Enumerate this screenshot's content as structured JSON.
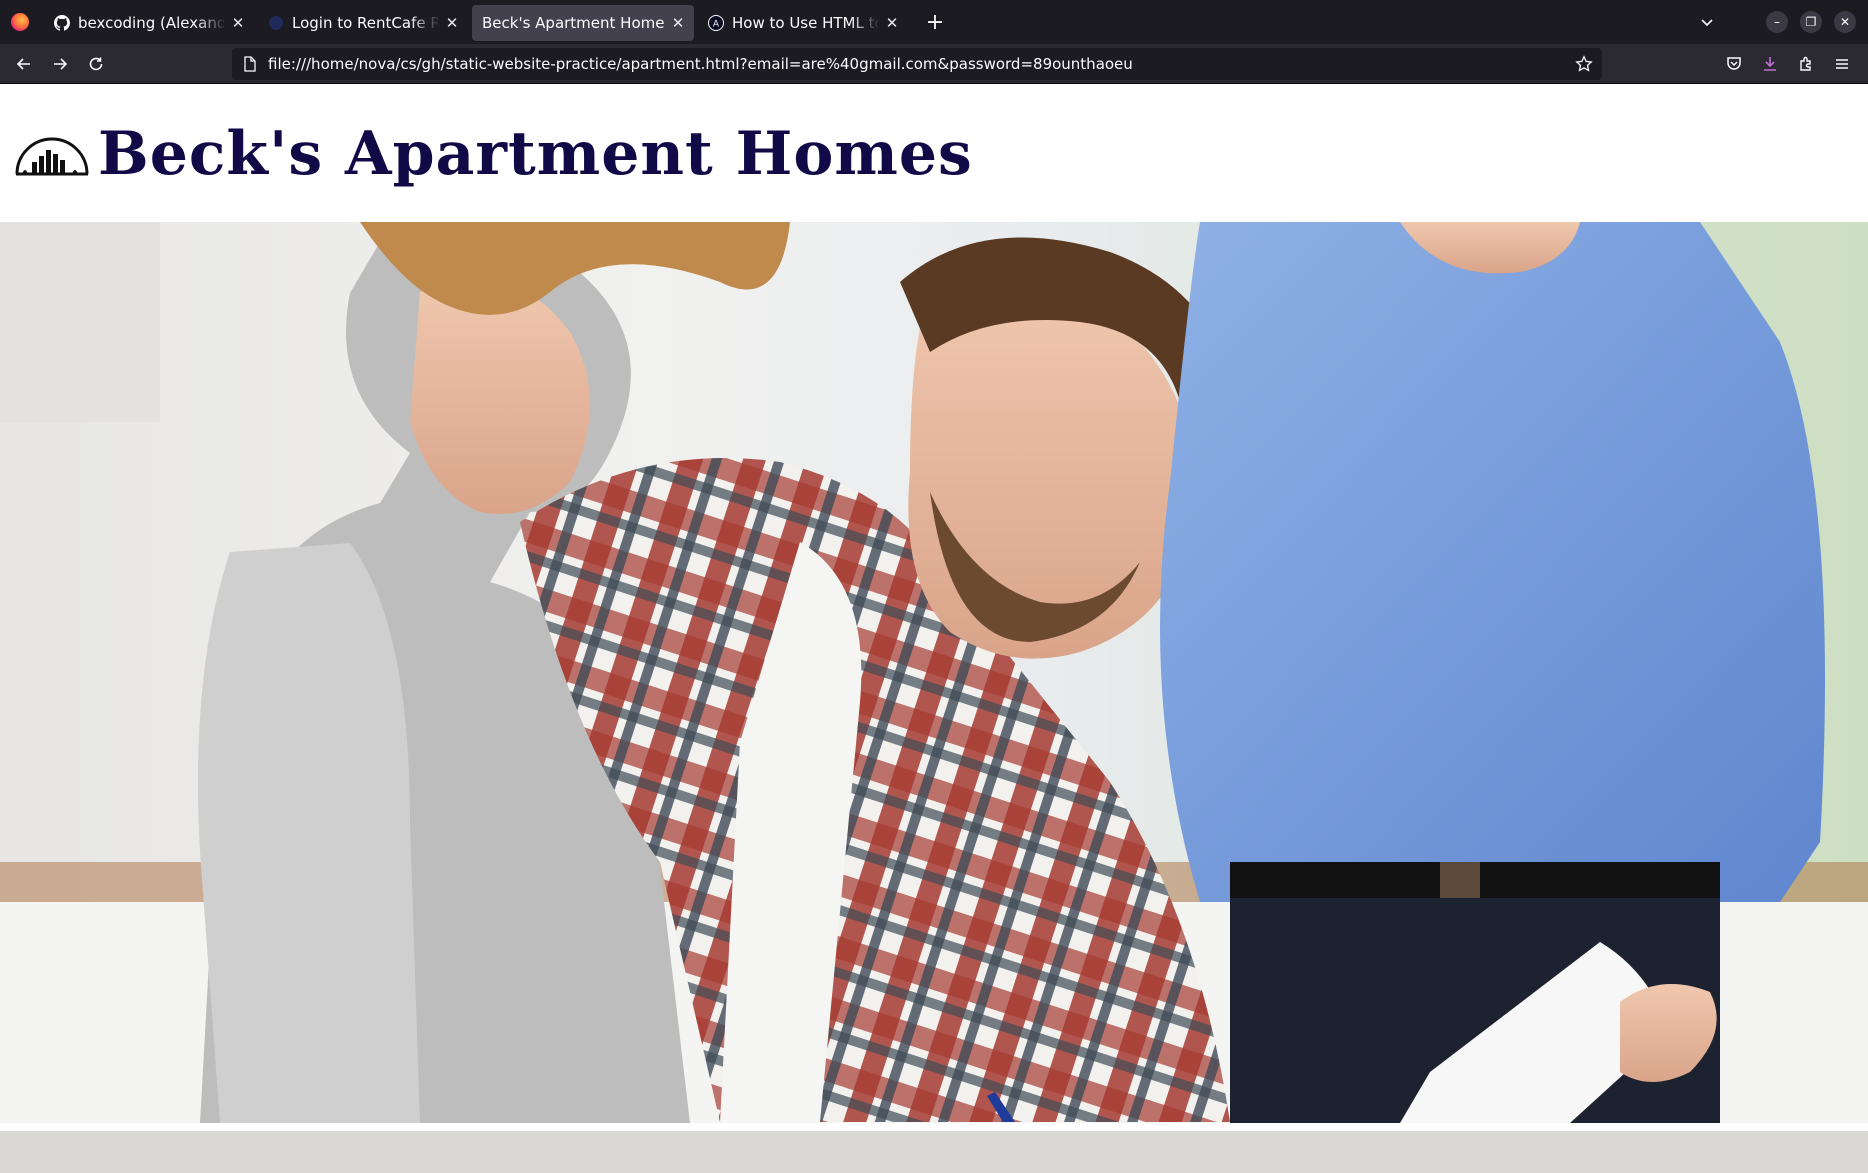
{
  "browser": {
    "tabs": [
      {
        "title": "bexcoding (Alexander Beck)",
        "favicon": "github-icon",
        "active": false
      },
      {
        "title": "Login to RentCafe Resident",
        "favicon": "rentcafe-icon",
        "active": false
      },
      {
        "title": "Beck's Apartment Homes",
        "favicon": "none",
        "active": true
      },
      {
        "title": "How to Use HTML to Open",
        "favicon": "freecodecamp-icon",
        "active": false
      }
    ],
    "url": "file:///home/nova/cs/gh/static-website-practice/apartment.html?email=are%40gmail.com&password=89ounthaoeu",
    "accent_download": "#c56fd8"
  },
  "site": {
    "title": "Beck's Apartment Homes",
    "title_color": "#120a47",
    "logo": "city-skyline-logo-icon",
    "hero_image": "couple-signing-lease-with-agent-photo"
  }
}
